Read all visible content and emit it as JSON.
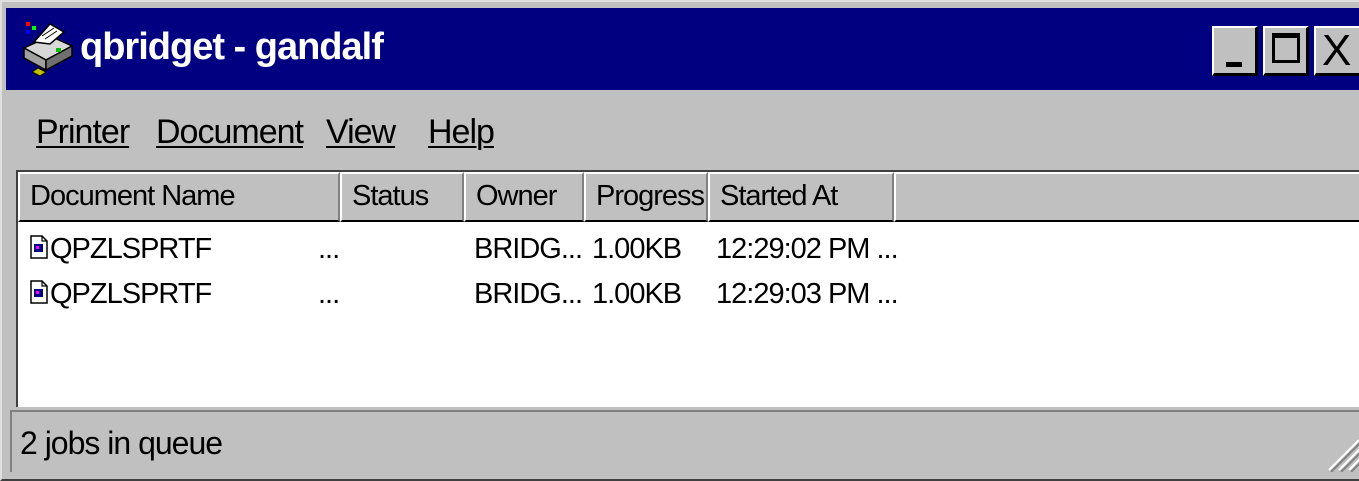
{
  "window": {
    "title": "qbridget - gandalf",
    "icon": "printer-icon",
    "controls": {
      "minimize": "minimize-icon",
      "maximize": "maximize-icon",
      "close": "X"
    }
  },
  "menu": {
    "items": [
      {
        "label": "Printer"
      },
      {
        "label": "Document"
      },
      {
        "label": "View"
      },
      {
        "label": "Help"
      }
    ]
  },
  "list": {
    "columns": [
      "Document Name",
      "Status",
      "Owner",
      "Progress",
      "Started At"
    ],
    "rows": [
      {
        "name": "QPZLSPRTF",
        "status": "...",
        "owner": "BRIDG...",
        "progress": "1.00KB",
        "started": "12:29:02 PM ..."
      },
      {
        "name": "QPZLSPRTF",
        "status": "...",
        "owner": "BRIDG...",
        "progress": "1.00KB",
        "started": "12:29:03 PM ..."
      }
    ]
  },
  "statusbar": {
    "text": "2 jobs in queue"
  },
  "colors": {
    "titlebar": "#000080",
    "face": "#c0c0c0",
    "list_background": "#ffffff"
  }
}
